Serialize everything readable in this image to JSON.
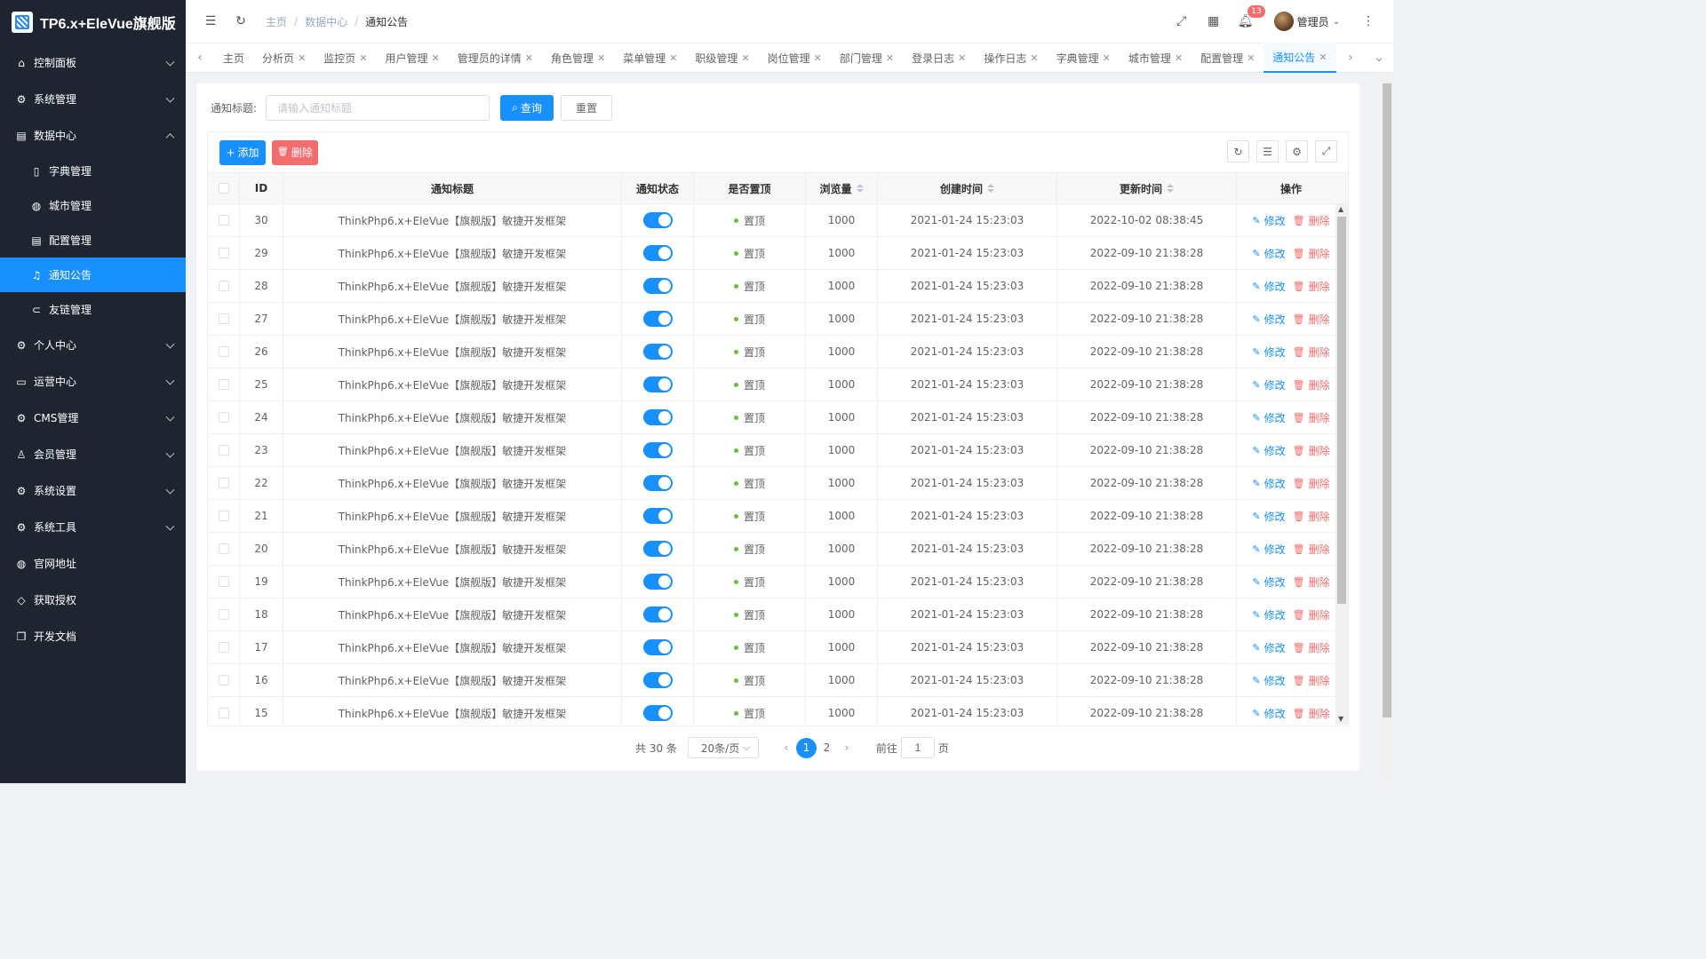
{
  "app": {
    "title": "TP6.x+EleVue旗舰版"
  },
  "sidebar": {
    "items": [
      {
        "label": "控制面板",
        "icon": "home-icon",
        "expanded": false
      },
      {
        "label": "系统管理",
        "icon": "gear-icon",
        "expanded": false
      },
      {
        "label": "数据中心",
        "icon": "database-icon",
        "expanded": true
      },
      {
        "label": "字典管理",
        "icon": "book-icon",
        "sub": true
      },
      {
        "label": "城市管理",
        "icon": "globe-icon",
        "sub": true
      },
      {
        "label": "配置管理",
        "icon": "list-icon",
        "sub": true
      },
      {
        "label": "通知公告",
        "icon": "bell-icon",
        "sub": true,
        "active": true
      },
      {
        "label": "友链管理",
        "icon": "link-icon",
        "sub": true
      },
      {
        "label": "个人中心",
        "icon": "gears-icon",
        "expanded": false
      },
      {
        "label": "运营中心",
        "icon": "card-icon",
        "expanded": false
      },
      {
        "label": "CMS管理",
        "icon": "gears-icon",
        "expanded": false
      },
      {
        "label": "会员管理",
        "icon": "user-icon",
        "expanded": false
      },
      {
        "label": "系统设置",
        "icon": "gears-icon",
        "expanded": false
      },
      {
        "label": "系统工具",
        "icon": "gears-icon",
        "expanded": false
      },
      {
        "label": "官网地址",
        "icon": "globe-icon"
      },
      {
        "label": "获取授权",
        "icon": "diamond-icon"
      },
      {
        "label": "开发文档",
        "icon": "copy-icon"
      }
    ]
  },
  "header": {
    "breadcrumb": [
      "主页",
      "数据中心",
      "通知公告"
    ],
    "notification_count": "13",
    "user_name": "管理员"
  },
  "tabs": [
    "主页",
    "分析页",
    "监控页",
    "用户管理",
    "管理员的详情",
    "角色管理",
    "菜单管理",
    "职级管理",
    "岗位管理",
    "部门管理",
    "登录日志",
    "操作日志",
    "字典管理",
    "城市管理",
    "配置管理",
    "通知公告"
  ],
  "active_tab": "通知公告",
  "search": {
    "label": "通知标题:",
    "placeholder": "请输入通知标题",
    "query_label": "查询",
    "reset_label": "重置"
  },
  "toolbar": {
    "add_label": "添加",
    "delete_label": "删除"
  },
  "table": {
    "columns": [
      "ID",
      "通知标题",
      "通知状态",
      "是否置顶",
      "浏览量",
      "创建时间",
      "更新时间",
      "操作"
    ],
    "rows": [
      {
        "id": "30",
        "title": "ThinkPhp6.x+EleVue【旗舰版】敏捷开发框架",
        "top": "置顶",
        "views": "1000",
        "created": "2021-01-24 15:23:03",
        "updated": "2022-10-02 08:38:45"
      },
      {
        "id": "29",
        "title": "ThinkPhp6.x+EleVue【旗舰版】敏捷开发框架",
        "top": "置顶",
        "views": "1000",
        "created": "2021-01-24 15:23:03",
        "updated": "2022-09-10 21:38:28"
      },
      {
        "id": "28",
        "title": "ThinkPhp6.x+EleVue【旗舰版】敏捷开发框架",
        "top": "置顶",
        "views": "1000",
        "created": "2021-01-24 15:23:03",
        "updated": "2022-09-10 21:38:28"
      },
      {
        "id": "27",
        "title": "ThinkPhp6.x+EleVue【旗舰版】敏捷开发框架",
        "top": "置顶",
        "views": "1000",
        "created": "2021-01-24 15:23:03",
        "updated": "2022-09-10 21:38:28"
      },
      {
        "id": "26",
        "title": "ThinkPhp6.x+EleVue【旗舰版】敏捷开发框架",
        "top": "置顶",
        "views": "1000",
        "created": "2021-01-24 15:23:03",
        "updated": "2022-09-10 21:38:28"
      },
      {
        "id": "25",
        "title": "ThinkPhp6.x+EleVue【旗舰版】敏捷开发框架",
        "top": "置顶",
        "views": "1000",
        "created": "2021-01-24 15:23:03",
        "updated": "2022-09-10 21:38:28"
      },
      {
        "id": "24",
        "title": "ThinkPhp6.x+EleVue【旗舰版】敏捷开发框架",
        "top": "置顶",
        "views": "1000",
        "created": "2021-01-24 15:23:03",
        "updated": "2022-09-10 21:38:28"
      },
      {
        "id": "23",
        "title": "ThinkPhp6.x+EleVue【旗舰版】敏捷开发框架",
        "top": "置顶",
        "views": "1000",
        "created": "2021-01-24 15:23:03",
        "updated": "2022-09-10 21:38:28"
      },
      {
        "id": "22",
        "title": "ThinkPhp6.x+EleVue【旗舰版】敏捷开发框架",
        "top": "置顶",
        "views": "1000",
        "created": "2021-01-24 15:23:03",
        "updated": "2022-09-10 21:38:28"
      },
      {
        "id": "21",
        "title": "ThinkPhp6.x+EleVue【旗舰版】敏捷开发框架",
        "top": "置顶",
        "views": "1000",
        "created": "2021-01-24 15:23:03",
        "updated": "2022-09-10 21:38:28"
      },
      {
        "id": "20",
        "title": "ThinkPhp6.x+EleVue【旗舰版】敏捷开发框架",
        "top": "置顶",
        "views": "1000",
        "created": "2021-01-24 15:23:03",
        "updated": "2022-09-10 21:38:28"
      },
      {
        "id": "19",
        "title": "ThinkPhp6.x+EleVue【旗舰版】敏捷开发框架",
        "top": "置顶",
        "views": "1000",
        "created": "2021-01-24 15:23:03",
        "updated": "2022-09-10 21:38:28"
      },
      {
        "id": "18",
        "title": "ThinkPhp6.x+EleVue【旗舰版】敏捷开发框架",
        "top": "置顶",
        "views": "1000",
        "created": "2021-01-24 15:23:03",
        "updated": "2022-09-10 21:38:28"
      },
      {
        "id": "17",
        "title": "ThinkPhp6.x+EleVue【旗舰版】敏捷开发框架",
        "top": "置顶",
        "views": "1000",
        "created": "2021-01-24 15:23:03",
        "updated": "2022-09-10 21:38:28"
      },
      {
        "id": "16",
        "title": "ThinkPhp6.x+EleVue【旗舰版】敏捷开发框架",
        "top": "置顶",
        "views": "1000",
        "created": "2021-01-24 15:23:03",
        "updated": "2022-09-10 21:38:28"
      },
      {
        "id": "15",
        "title": "ThinkPhp6.x+EleVue【旗舰版】敏捷开发框架",
        "top": "置顶",
        "views": "1000",
        "created": "2021-01-24 15:23:03",
        "updated": "2022-09-10 21:38:28"
      }
    ],
    "edit_label": "修改",
    "delete_label": "删除"
  },
  "pagination": {
    "total_text": "共 30 条",
    "page_size": "20条/页",
    "pages": [
      "1",
      "2"
    ],
    "current": "1",
    "goto_prefix": "前往",
    "goto_value": "1",
    "goto_suffix": "页"
  },
  "colors": {
    "primary": "#1890ff",
    "danger": "#f56c6c",
    "success": "#67c23a",
    "sidebar_bg": "#1f2431"
  }
}
